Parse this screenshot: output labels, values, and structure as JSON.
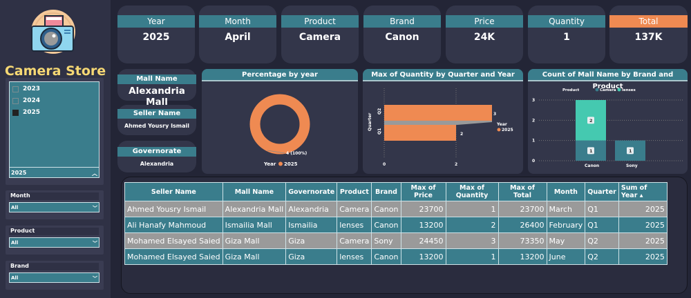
{
  "colors": {
    "teal": "#3a7d8c",
    "orange": "#ef8a52",
    "aqua": "#45c9b0",
    "title": "#f6d874"
  },
  "sidebar": {
    "title": "Camera Store",
    "year_options": [
      "2023",
      "2024",
      "2025"
    ],
    "year_selected": "2025",
    "filters": [
      {
        "label": "Month",
        "value": "All"
      },
      {
        "label": "Product",
        "value": "All"
      },
      {
        "label": "Brand",
        "value": "All"
      }
    ]
  },
  "kpis": [
    {
      "label": "Year",
      "value": "2025"
    },
    {
      "label": "Month",
      "value": "April"
    },
    {
      "label": "Product",
      "value": "Camera"
    },
    {
      "label": "Brand",
      "value": "Canon"
    },
    {
      "label": "Price",
      "value": "24K"
    },
    {
      "label": "Quantity",
      "value": "1"
    },
    {
      "label": "Total",
      "value": "137K"
    }
  ],
  "info": [
    {
      "label": "Mall Name",
      "value": "Alexandria Mall"
    },
    {
      "label": "Seller Name",
      "value": "Ahmed Yousry Ismail"
    },
    {
      "label": "Governorate",
      "value": "Alexandria"
    }
  ],
  "chart_data": [
    {
      "type": "pie",
      "title": "Percentage by year",
      "legend_title": "Year",
      "slices": [
        {
          "label": "2025",
          "value": 4,
          "data_label": "4 (100%)"
        }
      ]
    },
    {
      "type": "bar",
      "orientation": "horizontal",
      "title": "Max of Quantity by Quarter and Year",
      "ylabel": "Quarter",
      "legend_title": "Year",
      "legend": [
        "2025"
      ],
      "categories": [
        "Q2",
        "Q1"
      ],
      "values": [
        3,
        2
      ],
      "xticks": [
        "0",
        "2"
      ],
      "xlim": [
        0,
        3
      ]
    },
    {
      "type": "bar",
      "stacked": true,
      "title": "Count of Mall Name by Brand and Product",
      "legend_title": "Product",
      "categories": [
        "Canon",
        "Sony"
      ],
      "series": [
        {
          "name": "Camera",
          "values": [
            1,
            1
          ]
        },
        {
          "name": "lenses",
          "values": [
            2,
            0
          ]
        }
      ],
      "yticks": [
        "0",
        "1",
        "2",
        "3"
      ],
      "ylim": [
        0,
        3
      ]
    }
  ],
  "table": {
    "columns": [
      "Seller Name",
      "Mall Name",
      "Governorate",
      "Product",
      "Brand",
      "Max of Price",
      "Max of Quantity",
      "Max of Total",
      "Month",
      "Quarter",
      "Sum of Year"
    ],
    "rows": [
      [
        "Ahmed Yousry Ismail",
        "Alexandria Mall",
        "Alexandria",
        "Camera",
        "Canon",
        "23700",
        "1",
        "23700",
        "March",
        "Q1",
        "2025"
      ],
      [
        "Ali Hanafy Mahmoud",
        "Ismailia Mall",
        "Ismailia",
        "lenses",
        "Canon",
        "13200",
        "2",
        "26400",
        "February",
        "Q1",
        "2025"
      ],
      [
        "Mohamed Elsayed Saied",
        "Giza Mall",
        "Giza",
        "Camera",
        "Sony",
        "24450",
        "3",
        "73350",
        "May",
        "Q2",
        "2025"
      ],
      [
        "Mohamed Elsayed Saied",
        "Giza Mall",
        "Giza",
        "lenses",
        "Canon",
        "13200",
        "1",
        "13200",
        "June",
        "Q2",
        "2025"
      ]
    ]
  }
}
